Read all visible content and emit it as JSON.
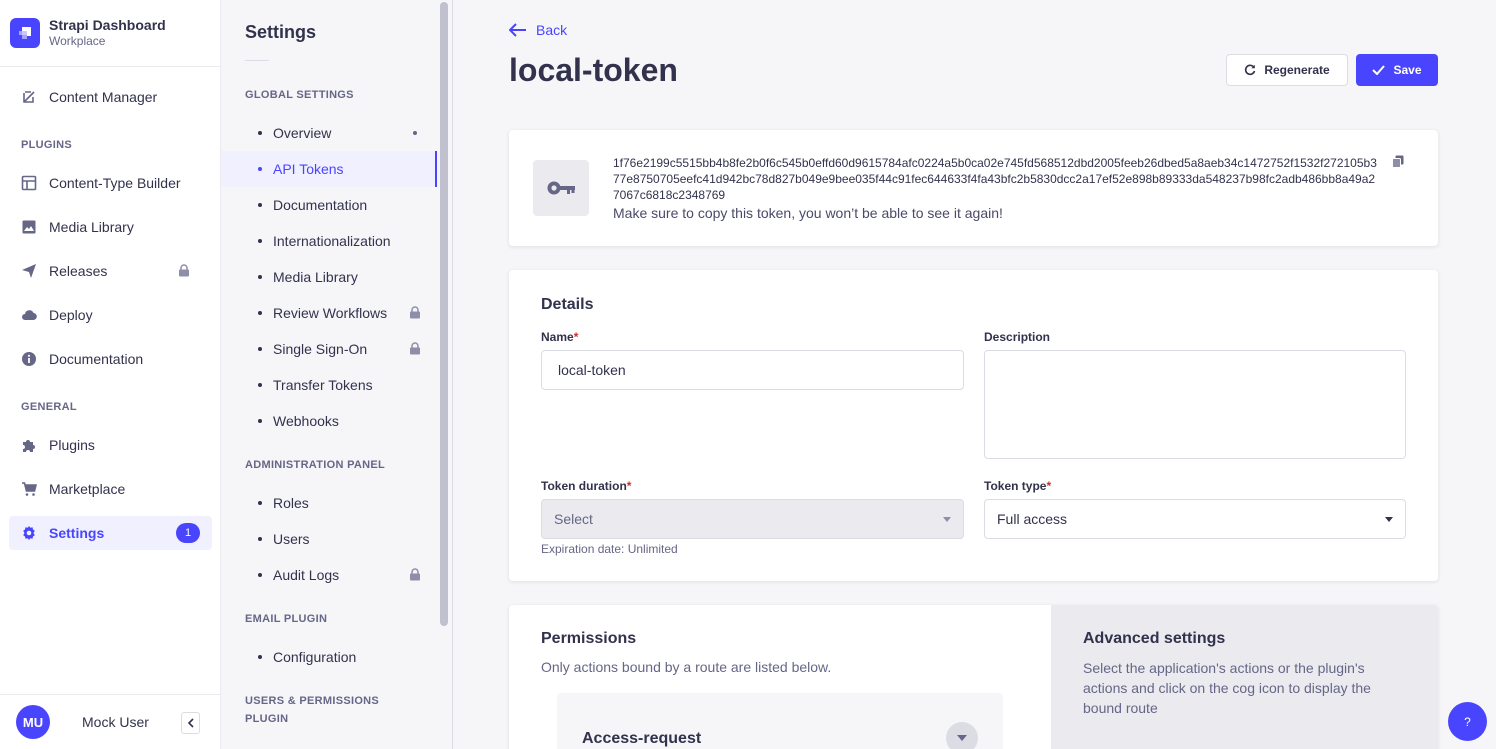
{
  "brand": {
    "title": "Strapi Dashboard",
    "subtitle": "Workplace"
  },
  "mainnav": {
    "content_manager": "Content Manager",
    "plugins_section": "PLUGINS",
    "content_type_builder": "Content-Type Builder",
    "media_library": "Media Library",
    "releases": "Releases",
    "deploy": "Deploy",
    "documentation": "Documentation",
    "general_section": "GENERAL",
    "plugins": "Plugins",
    "marketplace": "Marketplace",
    "settings": "Settings",
    "settings_badge": "1"
  },
  "user": {
    "initials": "MU",
    "name": "Mock User"
  },
  "subnav": {
    "title": "Settings",
    "global_section": "GLOBAL SETTINGS",
    "global_items": [
      "Overview",
      "API Tokens",
      "Documentation",
      "Internationalization",
      "Media Library",
      "Review Workflows",
      "Single Sign-On",
      "Transfer Tokens",
      "Webhooks"
    ],
    "admin_section": "ADMINISTRATION PANEL",
    "admin_items": [
      "Roles",
      "Users",
      "Audit Logs"
    ],
    "email_section": "EMAIL PLUGIN",
    "email_items": [
      "Configuration"
    ],
    "users_section": "USERS & PERMISSIONS PLUGIN"
  },
  "header": {
    "back": "Back",
    "title": "local-token",
    "regenerate": "Regenerate",
    "save": "Save"
  },
  "token": {
    "value": "1f76e2199c5515bb4b8fe2b0f6c545b0effd60d9615784afc0224a5b0ca02e745fd568512dbd2005feeb26dbed5a8aeb34c1472752f1532f272105b377e8750705eefc41d942bc78d827b049e9bee035f44c91fec644633f4fa43bfc2b5830dcc2a17ef52e898b89333da548237b98fc2adb486bb8a49a27067c6818c2348769",
    "note": "Make sure to copy this token, you won’t be able to see it again!"
  },
  "details": {
    "heading": "Details",
    "name_label": "Name",
    "name_value": "local-token",
    "description_label": "Description",
    "description_value": "",
    "duration_label": "Token duration",
    "duration_value": "Select",
    "expiration_hint": "Expiration date: Unlimited",
    "type_label": "Token type",
    "type_value": "Full access",
    "required_mark": "*"
  },
  "permissions": {
    "title": "Permissions",
    "subtitle": "Only actions bound by a route are listed below.",
    "accordion_title": "Access-request",
    "advanced_title": "Advanced settings",
    "advanced_text": "Select the application's actions or the plugin's actions and click on the cog icon to display the bound route"
  },
  "help": {
    "label": "?"
  },
  "colors": {
    "accent": "#4945ff",
    "required": "#d02b20"
  }
}
